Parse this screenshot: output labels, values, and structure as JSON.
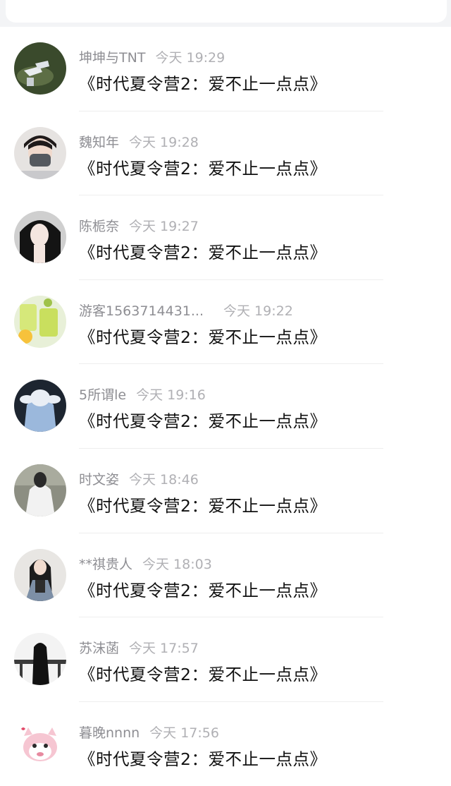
{
  "header": {
    "back_icon": "chevron-left-icon",
    "accent": "#2f8cf5"
  },
  "messages": [
    {
      "name": "坤坤与TNT",
      "time": "今天 19:29",
      "text": "《时代夏令营2：爱不止一点点》"
    },
    {
      "name": "魏知年",
      "time": "今天 19:28",
      "text": "《时代夏令营2：爱不止一点点》"
    },
    {
      "name": "陈栀奈",
      "time": "今天 19:27",
      "text": "《时代夏令营2：爱不止一点点》"
    },
    {
      "name": "游客1563714431...",
      "time": "今天 19:22",
      "text": "《时代夏令营2：爱不止一点点》"
    },
    {
      "name": "5所谓le",
      "time": "今天 19:16",
      "text": "《时代夏令营2：爱不止一点点》"
    },
    {
      "name": "时文姿",
      "time": "今天 18:46",
      "text": "《时代夏令营2：爱不止一点点》"
    },
    {
      "name": "**祺贵人",
      "time": "今天 18:03",
      "text": "《时代夏令营2：爱不止一点点》"
    },
    {
      "name": "苏沫菡",
      "time": "今天 17:57",
      "text": "《时代夏令营2：爱不止一点点》"
    },
    {
      "name": "暮晚nnnn",
      "time": "今天 17:56",
      "text": "《时代夏令营2：爱不止一点点》"
    }
  ]
}
